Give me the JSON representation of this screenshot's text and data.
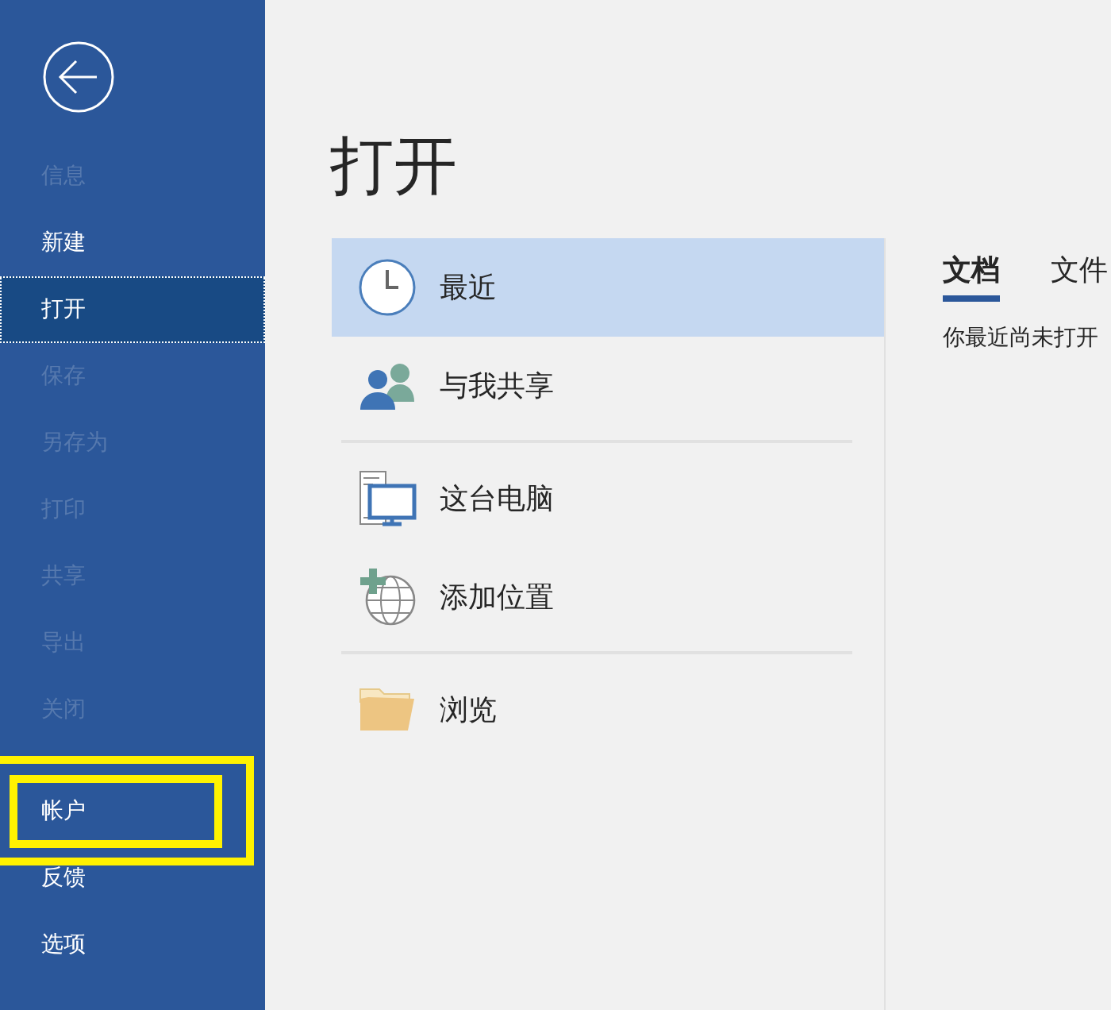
{
  "sidebar": {
    "groups": [
      [
        {
          "label": "信息",
          "disabled": true,
          "selected": false,
          "highlighted": false
        },
        {
          "label": "新建",
          "disabled": false,
          "selected": false,
          "highlighted": false
        },
        {
          "label": "打开",
          "disabled": false,
          "selected": true,
          "highlighted": false
        },
        {
          "label": "保存",
          "disabled": true,
          "selected": false,
          "highlighted": false
        },
        {
          "label": "另存为",
          "disabled": true,
          "selected": false,
          "highlighted": false
        },
        {
          "label": "打印",
          "disabled": true,
          "selected": false,
          "highlighted": false
        },
        {
          "label": "共享",
          "disabled": true,
          "selected": false,
          "highlighted": false
        },
        {
          "label": "导出",
          "disabled": true,
          "selected": false,
          "highlighted": false
        },
        {
          "label": "关闭",
          "disabled": true,
          "selected": false,
          "highlighted": false
        }
      ],
      [
        {
          "label": "帐户",
          "disabled": false,
          "selected": false,
          "highlighted": true
        },
        {
          "label": "反馈",
          "disabled": false,
          "selected": false,
          "highlighted": false
        },
        {
          "label": "选项",
          "disabled": false,
          "selected": false,
          "highlighted": false
        }
      ]
    ]
  },
  "page_title": "打开",
  "places": {
    "groups": [
      [
        {
          "label": "最近",
          "selected": true
        },
        {
          "label": "与我共享",
          "selected": false
        }
      ],
      [
        {
          "label": "这台电脑",
          "selected": false
        },
        {
          "label": "添加位置",
          "selected": false
        }
      ],
      [
        {
          "label": "浏览",
          "selected": false
        }
      ]
    ]
  },
  "tabs": [
    {
      "label": "文档",
      "selected": true
    },
    {
      "label": "文件",
      "selected": false
    }
  ],
  "message": "你最近尚未打开"
}
